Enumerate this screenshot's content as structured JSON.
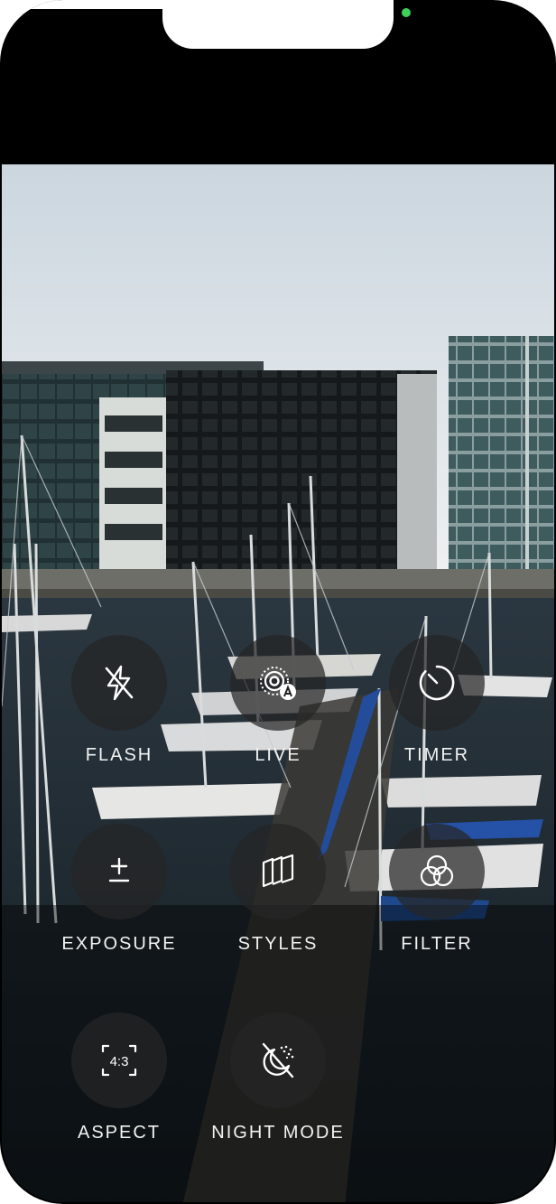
{
  "camera_options": {
    "flash": {
      "label": "FLASH",
      "icon": "flash-off-icon"
    },
    "live": {
      "label": "LIVE",
      "icon": "live-photo-auto-icon"
    },
    "timer": {
      "label": "TIMER",
      "icon": "timer-icon"
    },
    "exposure": {
      "label": "EXPOSURE",
      "icon": "exposure-plus-minus-icon"
    },
    "styles": {
      "label": "STYLES",
      "icon": "photographic-styles-icon"
    },
    "filter": {
      "label": "FILTER",
      "icon": "filter-icon"
    },
    "aspect": {
      "label": "ASPECT",
      "icon": "aspect-ratio-icon",
      "ratio": "4:3"
    },
    "night_mode": {
      "label": "NIGHT MODE",
      "icon": "night-mode-off-icon"
    }
  },
  "status": {
    "indicator": "camera-in-use-dot",
    "indicator_color": "#3fd15a"
  },
  "colors": {
    "sky_top": "#d5dee6",
    "sky_bottom": "#eef0f1",
    "water": "#1d2a33",
    "button_bg": "#262626",
    "label": "#f2f2f2"
  }
}
